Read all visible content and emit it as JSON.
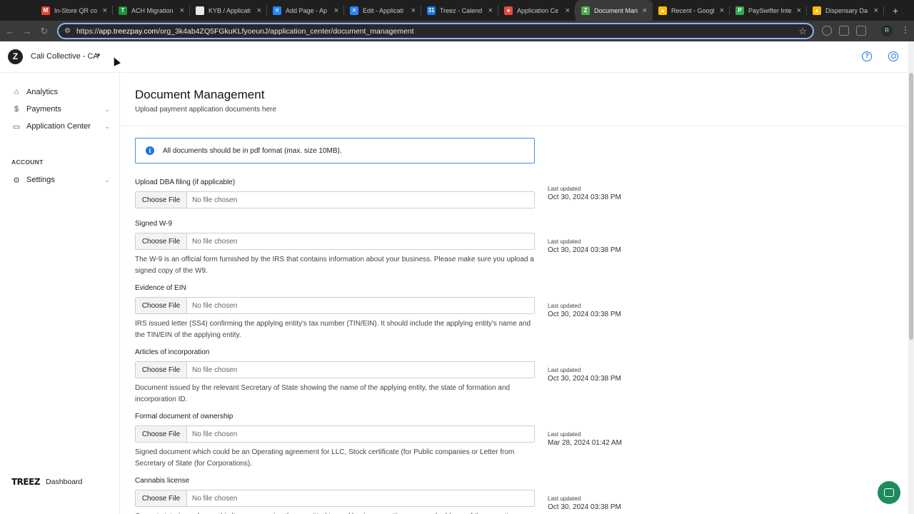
{
  "browser": {
    "tabs": [
      {
        "label": "In-Store QR co",
        "fav_color": "#ea4335",
        "fav_glyph": "M"
      },
      {
        "label": "ACH Migration",
        "fav_color": "#1e8e3e",
        "fav_glyph": "T"
      },
      {
        "label": "KYB / Applicati",
        "fav_color": "#e8e8e8",
        "fav_glyph": ""
      },
      {
        "label": "Add Page - Ap",
        "fav_color": "#2684ff",
        "fav_glyph": "✕"
      },
      {
        "label": "Edit - Applicati",
        "fav_color": "#2684ff",
        "fav_glyph": "✕"
      },
      {
        "label": "Treez - Calend",
        "fav_color": "#1a73e8",
        "fav_glyph": "31"
      },
      {
        "label": "Application Ce",
        "fav_color": "#e84a3a",
        "fav_glyph": "●"
      },
      {
        "label": "Document Man",
        "fav_color": "#4caf50",
        "fav_glyph": "Z"
      },
      {
        "label": "Recent - Googl",
        "fav_color": "#fbbc04",
        "fav_glyph": "▲"
      },
      {
        "label": "PaySwifter Inte",
        "fav_color": "#34a853",
        "fav_glyph": "P"
      },
      {
        "label": "Dispensary Da",
        "fav_color": "#fbbc04",
        "fav_glyph": "▲"
      }
    ],
    "active_tab": 7,
    "url_prefix": "https://",
    "url_host": "app.treezpay.com",
    "url_path": "/org_3k4ab4ZQ5FGkuKLfyoeunJ/application_center/document_management",
    "profile_initial": "R"
  },
  "header": {
    "org_name": "Cali Collective - CA"
  },
  "sidebar": {
    "items": [
      {
        "label": "Analytics",
        "icon": "home-icon"
      },
      {
        "label": "Payments",
        "icon": "dollar-icon"
      },
      {
        "label": "Application Center",
        "icon": "window-icon"
      }
    ],
    "section_label": "ACCOUNT",
    "settings_label": "Settings",
    "footer_logo": "TREEZ",
    "footer_label": "Dashboard"
  },
  "main": {
    "title": "Document Management",
    "subtitle": "Upload payment application documents here",
    "info": "All documents should be in pdf format (max. size 10MB).",
    "choose_label": "Choose File",
    "no_file_label": "No file chosen",
    "updated_label": "Last updated",
    "documents": [
      {
        "label": "Upload DBA filing (if applicable)",
        "desc": "",
        "updated": "Oct 30, 2024 03:38 PM"
      },
      {
        "label": "Signed W-9",
        "desc": "The W-9 is an official form furnished by the IRS that contains information about your business. Please make sure you upload a signed copy of the W9.",
        "updated": "Oct 30, 2024 03:38 PM"
      },
      {
        "label": "Evidence of EIN",
        "desc": "IRS issued letter (SS4) confirming the applying entity's tax number (TIN/EIN). It should include the applying entity's name and the TIN/EIN of the applying entity.",
        "updated": "Oct 30, 2024 03:38 PM"
      },
      {
        "label": "Articles of incorporation",
        "desc": "Document issued by the relevant Secretary of State showing the name of the applying entity, the state of formation and incorporation ID.",
        "updated": "Oct 30, 2024 03:38 PM"
      },
      {
        "label": "Formal document of ownership",
        "desc": "Signed document which could be an Operating agreement for LLC, Stock certificate (for Public companies or Letter from Secretary of State (for Corporations).",
        "updated": "Mar 28, 2024 01:42 AM"
      },
      {
        "label": "Cannabis license",
        "desc": "Current state-issued cannabis license covering the permitted type of business, entity name, and address of the operating",
        "updated": "Oct 30, 2024 03:38 PM"
      }
    ]
  }
}
